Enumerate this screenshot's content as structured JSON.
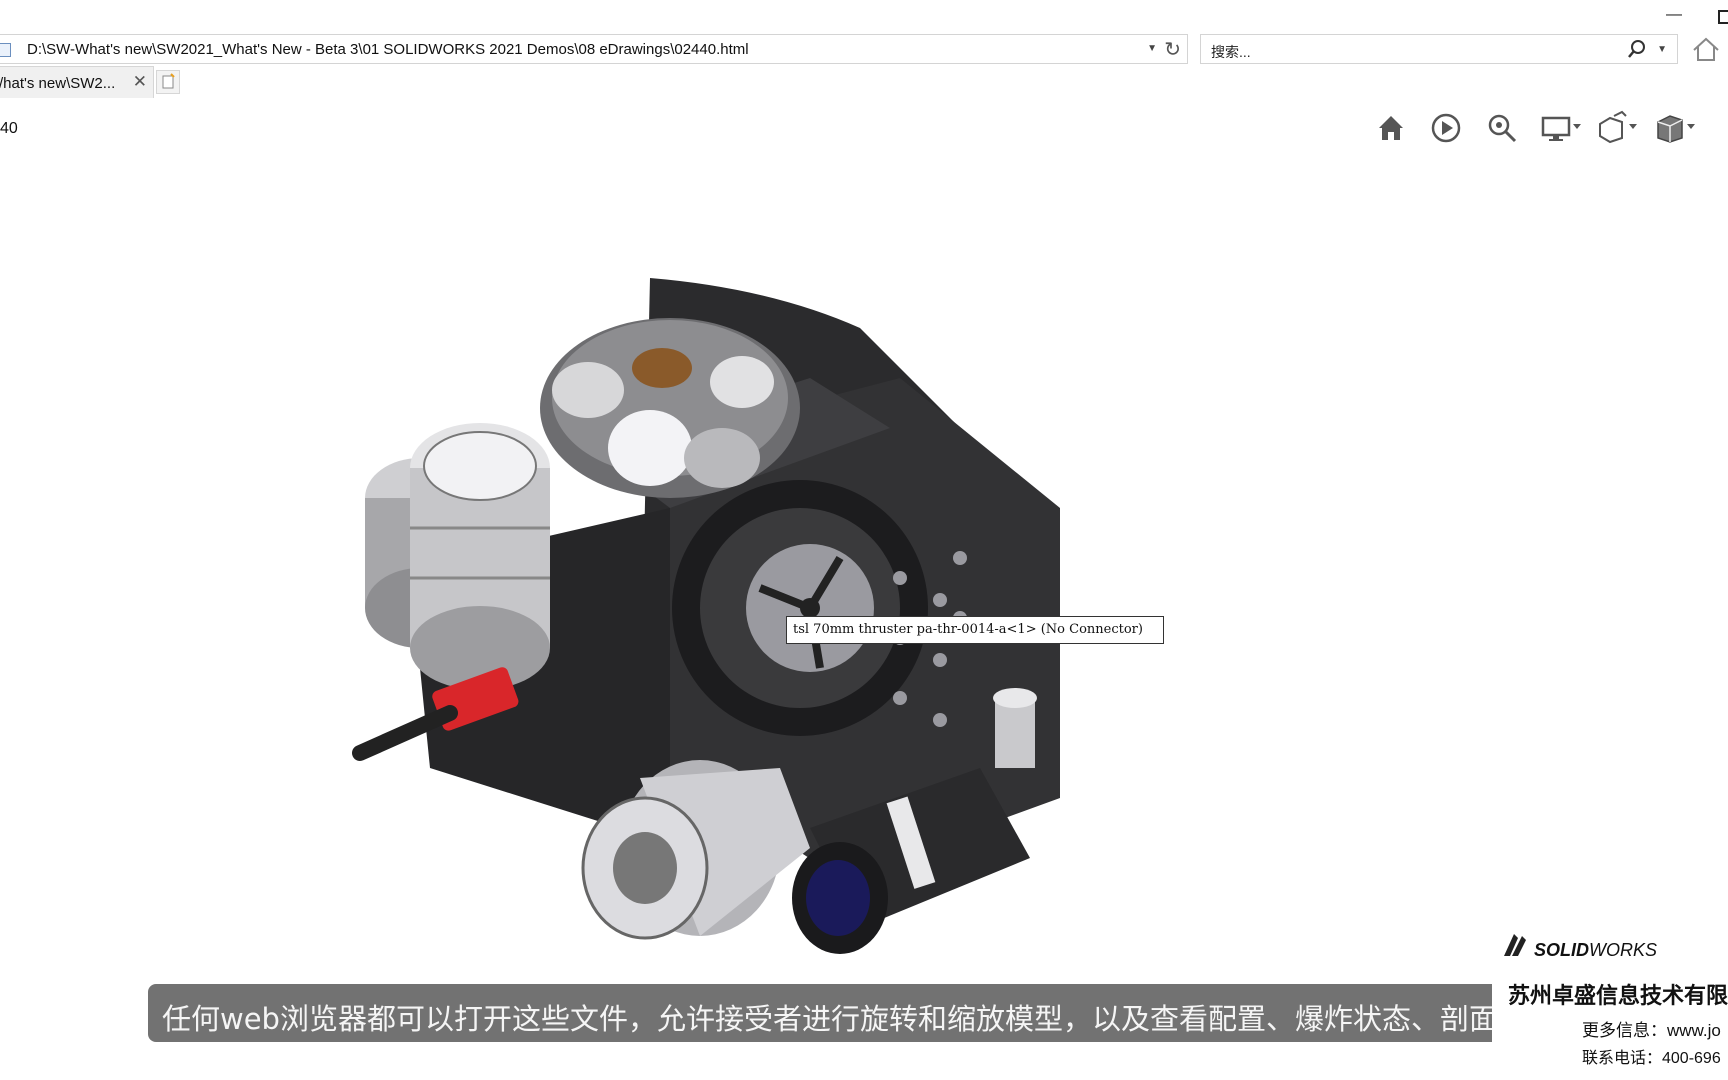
{
  "browser": {
    "address_url": "D:\\SW-What's new\\SW2021_What's New - Beta 3\\01 SOLIDWORKS 2021 Demos\\08 eDrawings\\02440.html",
    "search_placeholder": "搜索...",
    "tab_title": "/hat's new\\SW2..."
  },
  "viewer": {
    "page_number": "40",
    "toolbar_icons": [
      "home-icon",
      "play-icon",
      "zoom-icon",
      "display-icon",
      "explode-icon",
      "view-cube-icon"
    ],
    "tooltip": "tsl 70mm thruster pa-thr-0014-a<1> (No Connector)"
  },
  "caption": {
    "text": "任何web浏览器都可以打开这些文件，允许接受者进行旋转和缩放模型，以及查看配置、爆炸状态、剖面视"
  },
  "branding": {
    "logo_text": "SOLIDWORKS",
    "company": "苏州卓盛信息技术有限公司",
    "more_info": "更多信息：www.jo",
    "phone": "联系电话：400-696"
  },
  "colors": {
    "model_dark": "#2e2e30",
    "accent_red": "#d9262a",
    "caption_bg": "#3c3c3c"
  }
}
